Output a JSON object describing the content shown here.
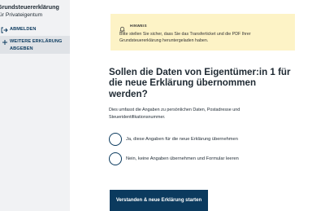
{
  "sidebar": {
    "app_title_line1": "Grundsteuererklärung",
    "app_title_line2": "für Privateigentum",
    "logout": {
      "label": "ABMELDEN",
      "icon": "logout-icon"
    },
    "next_declaration": {
      "label_line1": "WEITERE ERKLÄRUNG",
      "label_line2": "ABGEBEN",
      "icon": "plus-icon"
    }
  },
  "hint": {
    "title": "HINWEIS",
    "icon": "bell-icon",
    "text": "Bitte stellen Sie sicher, dass Sie das Transferticket und die PDF Ihrer Grundsteuererklärung heruntergeladen haben."
  },
  "main": {
    "question": "Sollen die Daten von Eigentümer:in 1 für die neue Erklärung übernommen werden?",
    "description": "Dies umfasst die Angaben zu persönlichen Daten, Postadresse und Steueridentifikationsnummer.",
    "options": [
      {
        "label": "Ja, diese Angaben für die neue Erklärung übernehmen"
      },
      {
        "label": "Nein, keine Angaben übernehmen und Formular leeren"
      }
    ],
    "submit_label": "Verstanden & neue Erklärung starten"
  },
  "colors": {
    "primary": "#0b3a5e",
    "hint_background": "#fdf3c6",
    "sidebar_background": "#f1f2f4",
    "sidebar_active": "#dfe2e6"
  }
}
